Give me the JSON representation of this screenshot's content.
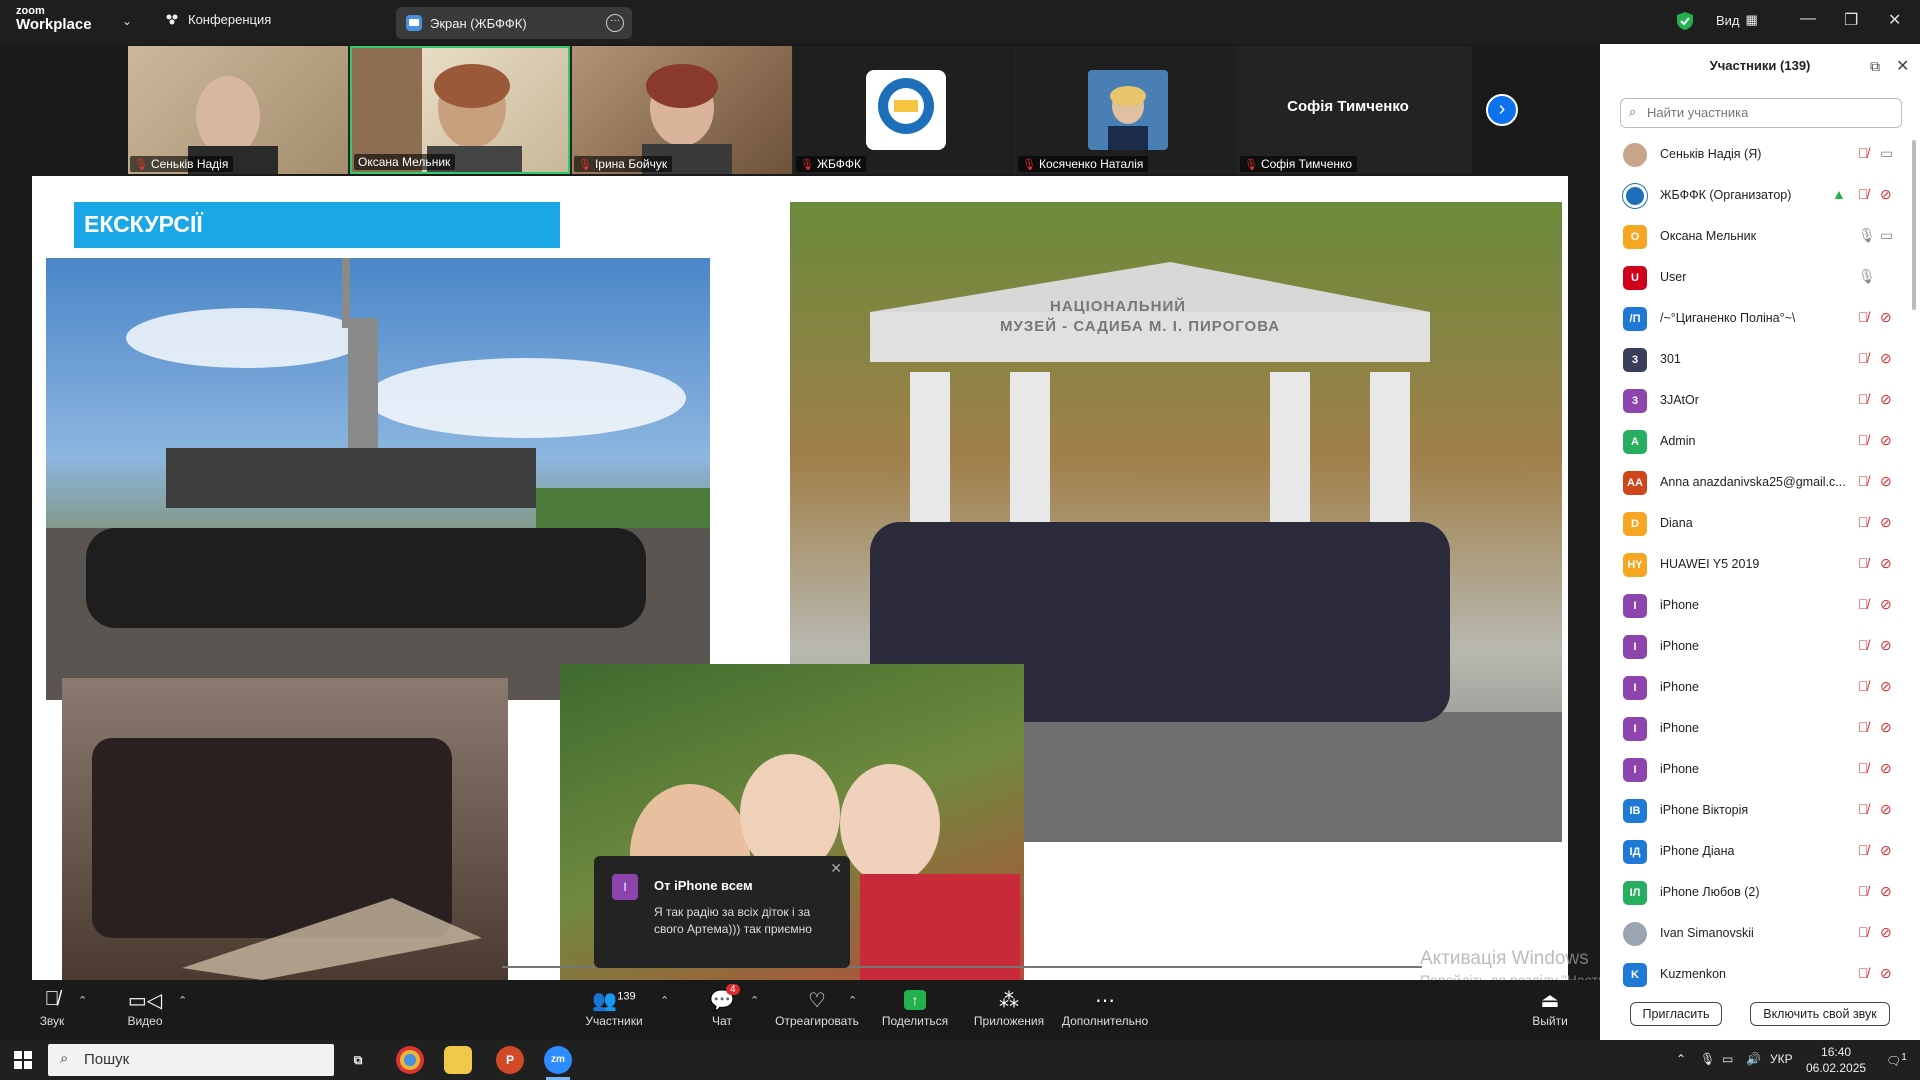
{
  "titlebar": {
    "logo_line1": "zoom",
    "logo_line2": "Workplace",
    "meeting_label": "Конференция",
    "share_tab_label": "Экран (ЖБФФК)",
    "view_label": "Вид"
  },
  "video_strip": {
    "tiles": [
      {
        "label": "Сеньків Надія"
      },
      {
        "label": "Оксана Мельник"
      },
      {
        "label": "Ірина Бойчук"
      },
      {
        "label": "ЖБФФК"
      },
      {
        "label": "Косяченко Наталія"
      },
      {
        "label": "Софія Тимченко",
        "big_name": "Софія Тимченко"
      }
    ]
  },
  "slide": {
    "title": "ЕКСКУРСІЇ",
    "arch_line1": "НАЦІОНАЛЬНИЙ",
    "arch_line2": "МУЗЕЙ - САДИБА М. І. ПИРОГОВА"
  },
  "chat_popup": {
    "avatar": "I",
    "from": "От iPhone всем",
    "message": "Я так радію за всіх діток і за свого Артема))) так приємно"
  },
  "watermark": {
    "line1": "Активація Windows",
    "line2": "Перейдіть до розділу \"Настройки\", щоб активувати Windows."
  },
  "toolbar": {
    "audio": "Звук",
    "video": "Видео",
    "participants": "Участники",
    "participants_count": "139",
    "chat": "Чат",
    "chat_badge": "4",
    "react": "Отреагировать",
    "share": "Поделиться",
    "apps": "Приложения",
    "more": "Дополнительно",
    "leave": "Выйти"
  },
  "panel": {
    "title": "Участники (139)",
    "search_placeholder": "Найти участника",
    "invite": "Пригласить",
    "unmute_me": "Включить свой звук",
    "participants": [
      {
        "initials": "",
        "name": "Сеньків Надія (Я)",
        "color": "#c8a48a",
        "photo": true,
        "mic": "muted",
        "cam": "on"
      },
      {
        "initials": "",
        "name": "ЖБФФК (Организатор)",
        "color": "#1c6fb8",
        "logo": true,
        "mic": "muted",
        "cam": "off",
        "share": true
      },
      {
        "initials": "О",
        "name": "Оксана Мельник",
        "color": "#f5a623",
        "mic": "on",
        "cam": "on"
      },
      {
        "initials": "U",
        "name": "User",
        "color": "#d0021b",
        "mic": "on",
        "cam": "none"
      },
      {
        "initials": "/П",
        "name": "/~°Циганенко Поліна°~\\",
        "color": "#1f7ad6",
        "mic": "muted",
        "cam": "off"
      },
      {
        "initials": "3",
        "name": "301",
        "color": "#3a3d5c",
        "mic": "muted",
        "cam": "off"
      },
      {
        "initials": "3",
        "name": "3JAtOr",
        "color": "#8e44ad",
        "mic": "muted",
        "cam": "off"
      },
      {
        "initials": "A",
        "name": "Admin",
        "color": "#27ae60",
        "mic": "muted",
        "cam": "off"
      },
      {
        "initials": "AA",
        "name": "Anna anazdanivska25@gmail.c...",
        "color": "#d0451b",
        "mic": "muted",
        "cam": "off"
      },
      {
        "initials": "D",
        "name": "Diana",
        "color": "#f5a623",
        "mic": "muted",
        "cam": "off"
      },
      {
        "initials": "HY",
        "name": "HUAWEI Y5 2019",
        "color": "#f5a623",
        "mic": "muted",
        "cam": "off"
      },
      {
        "initials": "I",
        "name": "iPhone",
        "color": "#8e44ad",
        "mic": "muted",
        "cam": "off"
      },
      {
        "initials": "I",
        "name": "iPhone",
        "color": "#8e44ad",
        "mic": "muted",
        "cam": "off"
      },
      {
        "initials": "I",
        "name": "iPhone",
        "color": "#8e44ad",
        "mic": "muted",
        "cam": "off"
      },
      {
        "initials": "I",
        "name": "iPhone",
        "color": "#8e44ad",
        "mic": "muted",
        "cam": "off"
      },
      {
        "initials": "I",
        "name": "iPhone",
        "color": "#8e44ad",
        "mic": "muted",
        "cam": "off"
      },
      {
        "initials": "IВ",
        "name": "iPhone Вікторія",
        "color": "#1f7ad6",
        "mic": "muted",
        "cam": "off"
      },
      {
        "initials": "IД",
        "name": "iPhone Діана",
        "color": "#1f7ad6",
        "mic": "muted",
        "cam": "off"
      },
      {
        "initials": "IЛ",
        "name": "iPhone Любов (2)",
        "color": "#27ae60",
        "mic": "muted",
        "cam": "off"
      },
      {
        "initials": "",
        "name": "Ivan Simanovskii",
        "color": "#9aa5b1",
        "photo": true,
        "mic": "muted",
        "cam": "off"
      },
      {
        "initials": "K",
        "name": "Kuzmenkon",
        "color": "#1f7ad6",
        "mic": "muted",
        "cam": "off"
      }
    ]
  },
  "taskbar": {
    "search_label": "Пошук",
    "lang": "УКР",
    "time": "16:40",
    "date": "06.02.2025",
    "notifications": "1"
  }
}
